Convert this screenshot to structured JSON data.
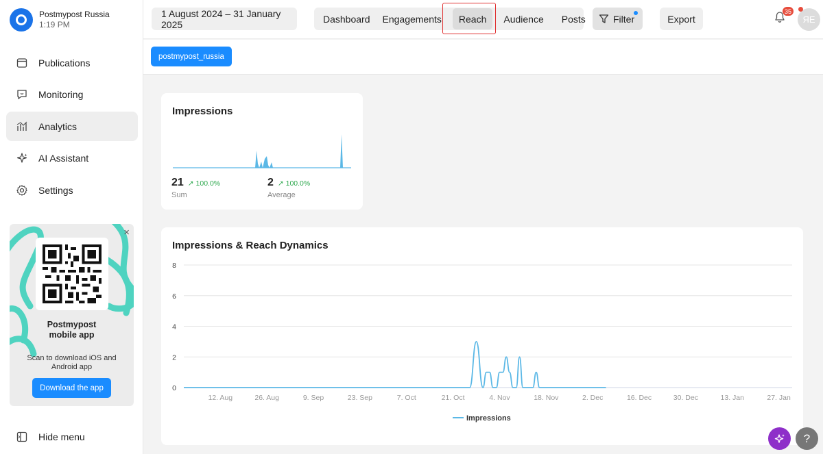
{
  "brand": {
    "name": "Postmypost Russia",
    "time": "1:19 PM"
  },
  "sidebar": {
    "items": [
      {
        "label": "Publications",
        "icon": "calendar-icon"
      },
      {
        "label": "Monitoring",
        "icon": "chat-icon"
      },
      {
        "label": "Analytics",
        "icon": "analytics-icon",
        "active": true
      },
      {
        "label": "AI Assistant",
        "icon": "sparkle-icon"
      },
      {
        "label": "Settings",
        "icon": "gear-icon"
      }
    ],
    "hide_menu": "Hide menu"
  },
  "promo": {
    "title": "Postmypost mobile app",
    "subtitle": "Scan to download iOS and Android app",
    "button": "Download the app",
    "close": "×"
  },
  "topbar": {
    "date_range": "1 August 2024 – 31 January 2025",
    "tabs": [
      "Dashboard",
      "Engagements",
      "Reach",
      "Audience",
      "Posts"
    ],
    "active_tab": "Reach",
    "filter": "Filter",
    "export": "Export",
    "notifications": "35",
    "avatar": "ЯЕ"
  },
  "account_chip": "postmypost_russia",
  "impressions_card": {
    "title": "Impressions",
    "sum": {
      "value": "21",
      "delta": "100.0%",
      "label": "Sum"
    },
    "average": {
      "value": "2",
      "delta": "100.0%",
      "label": "Average"
    }
  },
  "dynamics_card": {
    "title": "Impressions & Reach Dynamics"
  },
  "chart_data": {
    "type": "line",
    "title": "Impressions & Reach Dynamics",
    "x_ticks": [
      "12. Aug",
      "26. Aug",
      "9. Sep",
      "23. Sep",
      "7. Oct",
      "21. Oct",
      "4. Nov",
      "18. Nov",
      "2. Dec",
      "16. Dec",
      "30. Dec",
      "13. Jan",
      "27. Jan"
    ],
    "y_ticks": [
      0,
      2,
      4,
      6,
      8
    ],
    "ylim": [
      0,
      8
    ],
    "xlim": [
      "2024-08-01",
      "2025-01-31"
    ],
    "grid": true,
    "legend_placement": "bottom-center",
    "series": [
      {
        "name": "Impressions",
        "color": "#5bb8e6",
        "points": [
          [
            "2024-08-01",
            0
          ],
          [
            "2024-10-26",
            0
          ],
          [
            "2024-10-28",
            3
          ],
          [
            "2024-10-30",
            0
          ],
          [
            "2024-10-31",
            1
          ],
          [
            "2024-11-01",
            1
          ],
          [
            "2024-11-02",
            0
          ],
          [
            "2024-11-03",
            0
          ],
          [
            "2024-11-04",
            1
          ],
          [
            "2024-11-05",
            1
          ],
          [
            "2024-11-06",
            2
          ],
          [
            "2024-11-07",
            1
          ],
          [
            "2024-11-08",
            0
          ],
          [
            "2024-11-09",
            0
          ],
          [
            "2024-11-10",
            2
          ],
          [
            "2024-11-11",
            0
          ],
          [
            "2024-11-14",
            0
          ],
          [
            "2024-11-15",
            1
          ],
          [
            "2024-11-16",
            0
          ],
          [
            "2024-12-06",
            0
          ]
        ]
      }
    ]
  },
  "colors": {
    "accent": "#1a8cff",
    "series": "#5bb8e6",
    "positive": "#2ea84e",
    "ai": "#8e2fc9",
    "highlight": "#e03030"
  }
}
